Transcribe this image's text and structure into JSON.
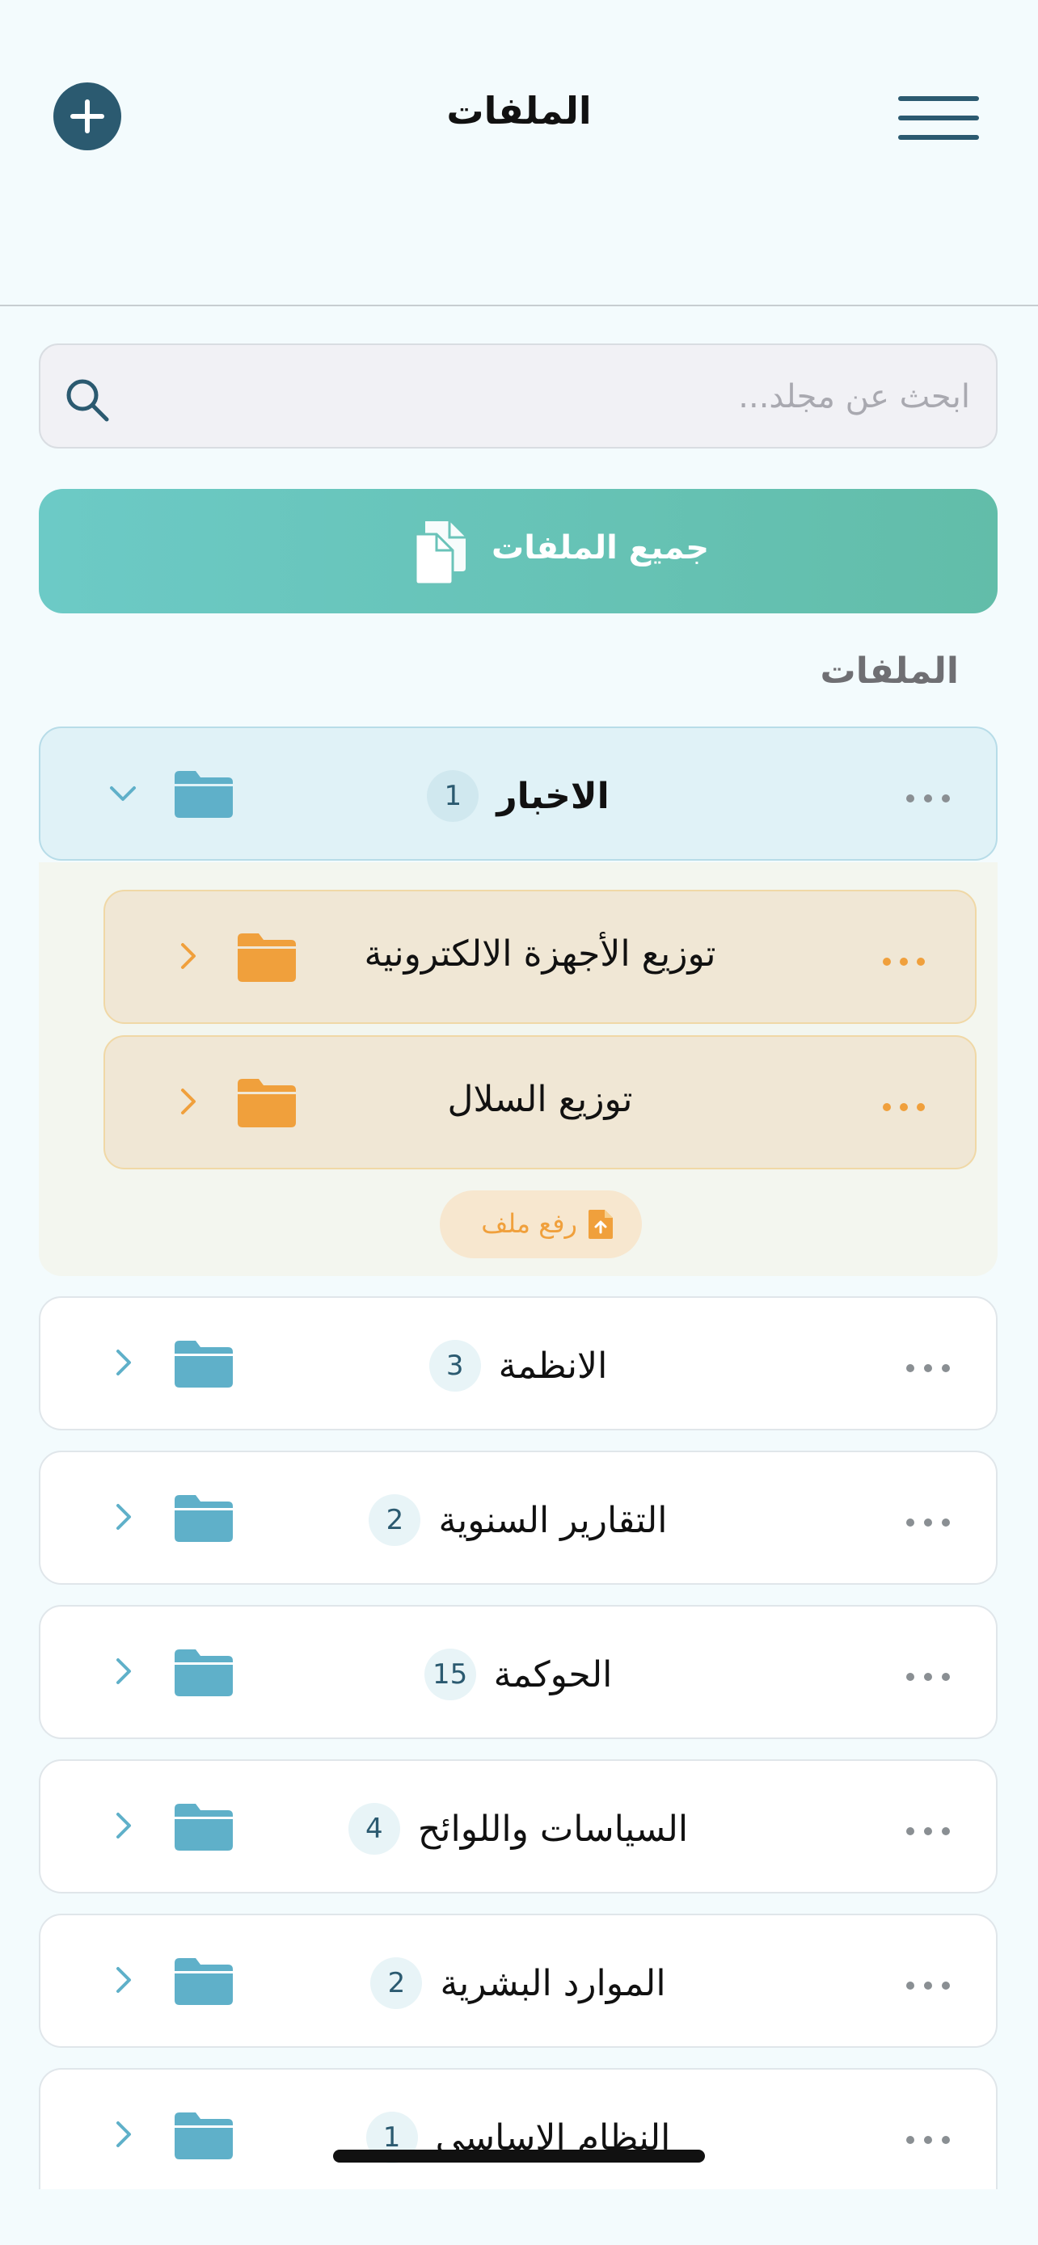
{
  "header": {
    "title": "الملفات",
    "add_icon": "plus-circle-icon",
    "menu_icon": "hamburger-menu-icon"
  },
  "search": {
    "placeholder": "ابحث عن مجلد...",
    "value": ""
  },
  "all_files_button": {
    "label": "جميع الملفات",
    "icon": "files-icon"
  },
  "section_title": "الملفات",
  "folders": [
    {
      "name": "الاخبار",
      "count": "1",
      "expanded": true,
      "subfolders": [
        {
          "name": "توزيع الأجهزة الالكترونية"
        },
        {
          "name": "توزيع السلال"
        }
      ],
      "upload_label": "رفع ملف"
    },
    {
      "name": "الانظمة",
      "count": "3"
    },
    {
      "name": "التقارير السنوية",
      "count": "2"
    },
    {
      "name": "الحوكمة",
      "count": "15"
    },
    {
      "name": "السياسات واللوائح",
      "count": "4"
    },
    {
      "name": "الموارد البشرية",
      "count": "2"
    },
    {
      "name": "النظام الاساسي",
      "count": "1"
    }
  ],
  "colors": {
    "primary": "#2b5a70",
    "folder_blue": "#5fb0c9",
    "folder_orange": "#f0a03c",
    "accent_gradient_start": "#6ccac6",
    "accent_gradient_end": "#62bda9",
    "background": "#f3fbfd"
  }
}
